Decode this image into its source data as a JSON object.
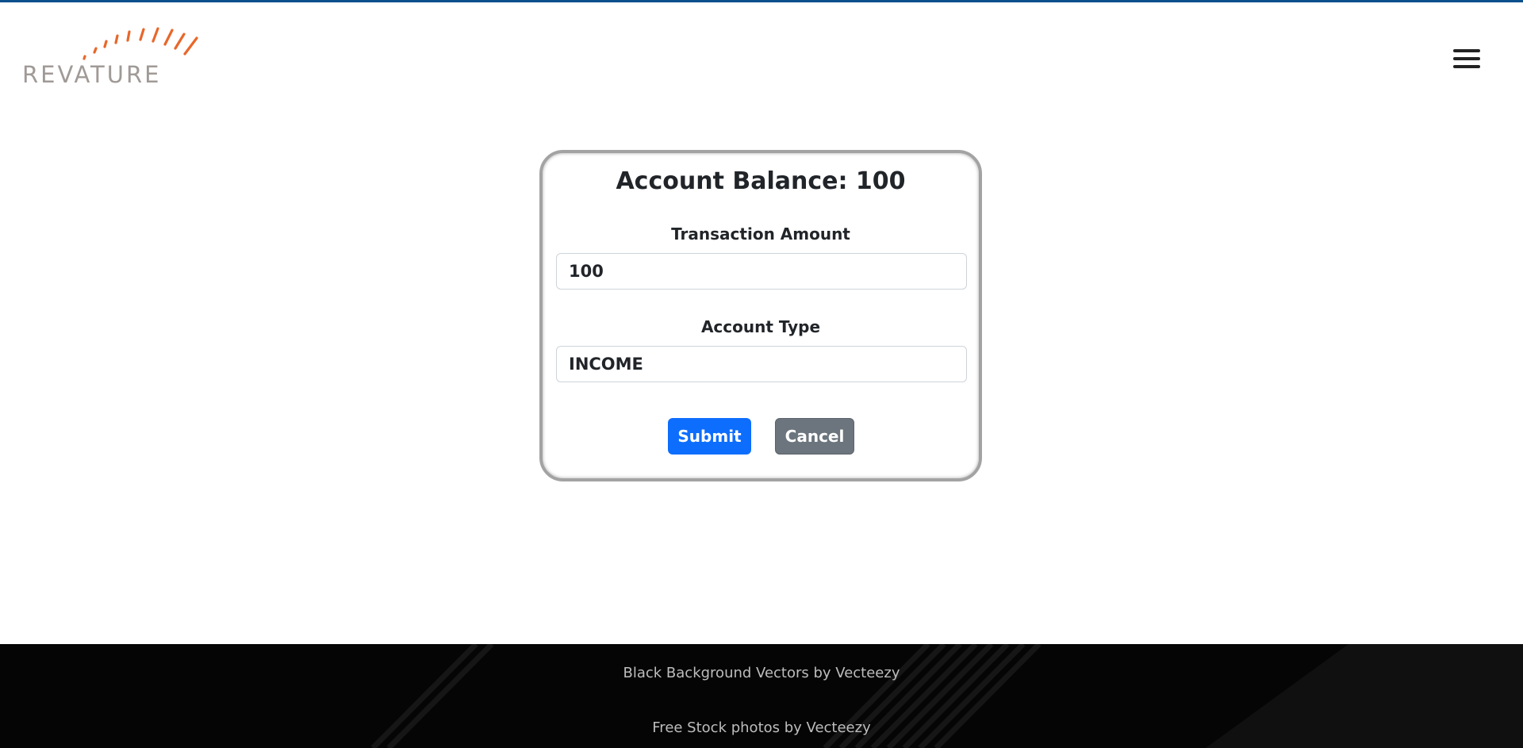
{
  "brand": {
    "name": "REVATURE",
    "accent": "#e8672a"
  },
  "header": {
    "menu_icon": "hamburger-menu-icon"
  },
  "card": {
    "balance_label": "Account Balance: 100",
    "transaction_amount_label": "Transaction Amount",
    "transaction_amount_value": "100",
    "account_type_label": "Account Type",
    "account_type_value": "INCOME",
    "submit_label": "Submit",
    "cancel_label": "Cancel"
  },
  "footer": {
    "link1": "Black Background Vectors by Vecteezy",
    "link2": "Free Stock photos by Vecteezy"
  },
  "colors": {
    "primary": "#0d6efd",
    "secondary": "#6c757d",
    "footer_bg": "#050505",
    "top_line": "#0b4f8c"
  }
}
